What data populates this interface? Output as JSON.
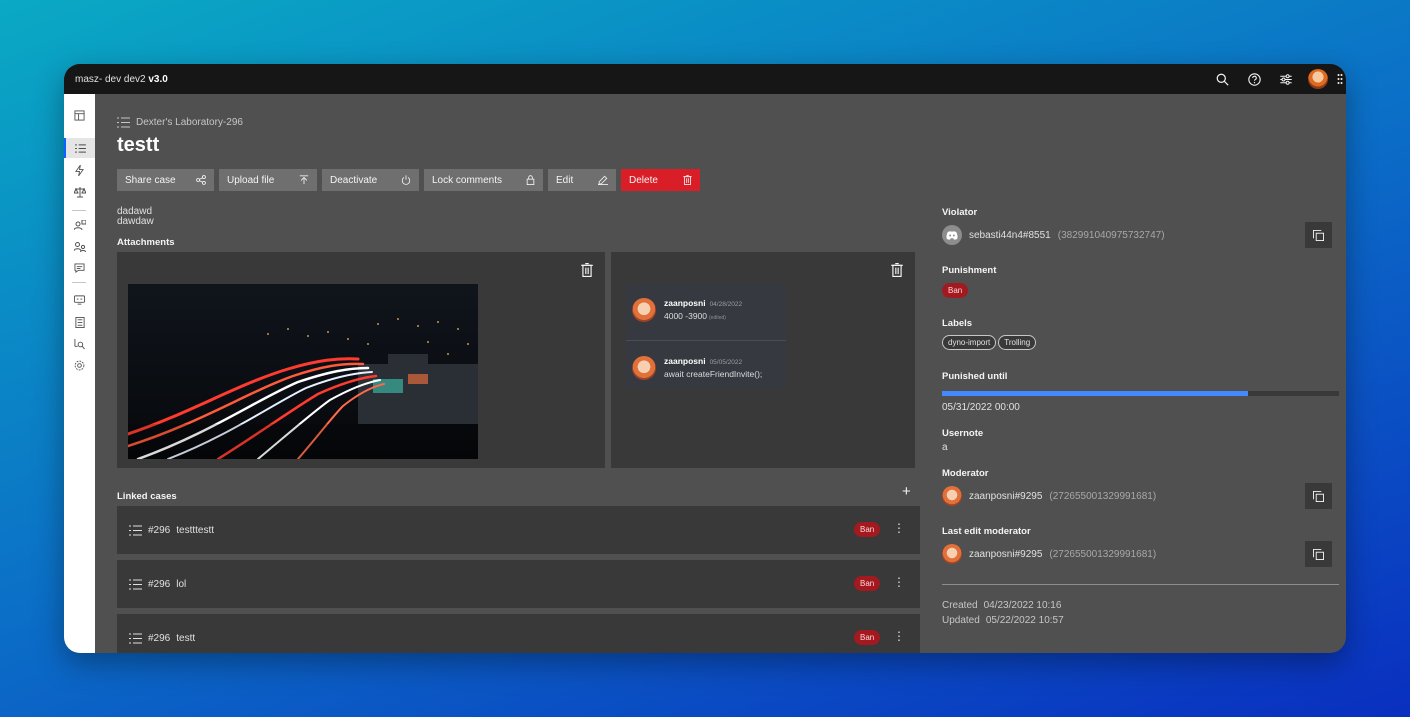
{
  "topbar": {
    "brand_prefix": "masz- dev dev2 ",
    "brand_version": "v3.0",
    "icons": [
      "search-icon",
      "help-icon",
      "settings-sliders-icon",
      "avatar",
      "app-switcher-icon"
    ]
  },
  "sidebar": {
    "items": [
      {
        "name": "dashboard-icon"
      },
      {
        "name": "cases-list-icon",
        "active": true
      },
      {
        "name": "automod-icon"
      },
      {
        "name": "scales-icon"
      },
      {
        "name": "user-notes-icon"
      },
      {
        "name": "user-mapping-icon"
      },
      {
        "name": "comments-icon"
      },
      {
        "name": "motd-icon"
      },
      {
        "name": "audit-log-icon"
      },
      {
        "name": "search-user-icon"
      },
      {
        "name": "settings-icon"
      }
    ]
  },
  "breadcrumb": "Dexter's Laboratory-296",
  "case": {
    "title": "testt",
    "description_lines": [
      "dadawd",
      "dawdaw"
    ]
  },
  "actions": {
    "share": "Share case",
    "upload": "Upload file",
    "deactivate": "Deactivate",
    "lock": "Lock comments",
    "edit": "Edit",
    "delete": "Delete"
  },
  "attachments": {
    "heading": "Attachments",
    "messages": [
      {
        "author": "zaanposni",
        "date": "04/28/2022",
        "text": "4000 -3900",
        "edited": "(edited)"
      },
      {
        "author": "zaanposni",
        "date": "05/05/2022",
        "text": "await createFriendInvite();"
      }
    ]
  },
  "linked": {
    "heading": "Linked cases",
    "rows": [
      {
        "num": "#296",
        "title": "testttestt",
        "badge": "Ban"
      },
      {
        "num": "#296",
        "title": "lol",
        "badge": "Ban"
      },
      {
        "num": "#296",
        "title": "testt",
        "badge": "Ban"
      }
    ]
  },
  "details": {
    "violator_label": "Violator",
    "violator_name": "sebasti44n4#8551",
    "violator_id": "(382991040975732747)",
    "punishment_label": "Punishment",
    "punishment": "Ban",
    "labels_label": "Labels",
    "labels": [
      "dyno-import",
      "Trolling"
    ],
    "punished_until_label": "Punished until",
    "punished_until": "05/31/2022 00:00",
    "punishment_progress": 0.77,
    "usernote_label": "Usernote",
    "usernote": "a",
    "moderator_label": "Moderator",
    "moderator_name": "zaanposni#9295",
    "moderator_id": "(272655001329991681)",
    "last_edit_label": "Last edit moderator",
    "last_edit_name": "zaanposni#9295",
    "last_edit_id": "(272655001329991681)",
    "created_label": "Created",
    "created": "04/23/2022 10:16",
    "updated_label": "Updated",
    "updated": "05/22/2022 10:57"
  },
  "colors": {
    "danger": "#da1e28",
    "badge": "#a2191f",
    "progress": "#4589ff",
    "accent": "#0f62fe"
  }
}
